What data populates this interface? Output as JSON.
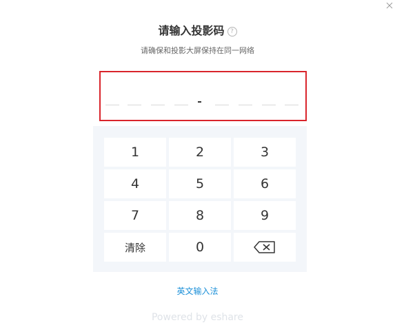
{
  "dialog": {
    "title": "请输入投影码",
    "help_glyph": "?",
    "subtitle": "请确保和投影大屏保持在同一网络"
  },
  "code_input": {
    "entered_value": "",
    "separator": "-",
    "slot_count": 8,
    "border_color": "#d9232a"
  },
  "keypad": {
    "keys": {
      "k1": "1",
      "k2": "2",
      "k3": "3",
      "k4": "4",
      "k5": "5",
      "k6": "6",
      "k7": "7",
      "k8": "8",
      "k9": "9",
      "clear": "清除",
      "k0": "0"
    },
    "backspace_icon": "backspace-icon",
    "background_color": "#f3f6fa"
  },
  "ime_link": "英文输入法",
  "footer": "Powered by eshare",
  "icons": {
    "close": "close-icon",
    "help": "help-icon"
  },
  "colors": {
    "accent_link": "#1a8fd8",
    "text_primary": "#333333"
  }
}
